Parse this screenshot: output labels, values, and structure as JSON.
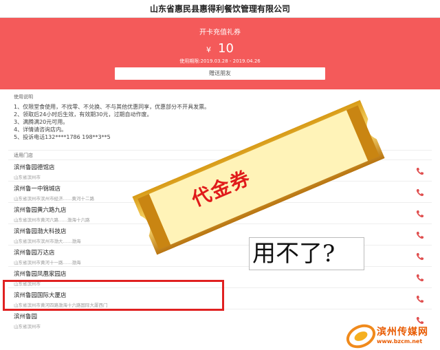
{
  "header": {
    "title": "山东省惠民县惠得利餐饮管理有限公司"
  },
  "hero": {
    "title": "开卡充值礼券",
    "currency": "¥",
    "amount": "10",
    "validity": "使用期限:2019.03.28 - 2019.04.26",
    "button_label": "赠送朋友"
  },
  "rules": {
    "heading": "使用说明",
    "items": [
      "1、仅限堂食使用，不找零、不兑换、不与其他优惠同享，优惠部分不开具发票。",
      "2、领取后24小时后生效，有效期30元，过期自动作废。",
      "3、满腾满20元可用。",
      "4、详情请咨询店内。",
      "5、投诉电话132****1786 198**3**5"
    ]
  },
  "stores": {
    "heading": "适用门店",
    "items": [
      {
        "name": "滨州鲁园德馆店",
        "address": "山东省滨州市"
      },
      {
        "name": "滨州鲁一中锦城店",
        "address": "山东省滨州市滨州市经济……黄河十二路"
      },
      {
        "name": "滨州鲁园黄六路九店",
        "address": "山东省滨州市黄河六路……渤海十六路"
      },
      {
        "name": "滨州鲁园渤大科技店",
        "address": "山东省滨州市滨州市渤大……渤海"
      },
      {
        "name": "滨州鲁园万达店",
        "address": "山东省滨州市黄河十一路……渤海"
      },
      {
        "name": "滨州鲁园凤凰家园店",
        "address": "山东省滨州市"
      },
      {
        "name": "滨州鲁园国际大厦店",
        "address": "山东省滨州市黄河四路渤海十六路国际大厦西门"
      },
      {
        "name": "滨州鲁园",
        "address": "山东省滨州市"
      }
    ]
  },
  "overlay": {
    "voucher_text": "代金券",
    "question_text": "用不了?"
  },
  "watermark": {
    "name": "滨州传媒网",
    "url": "www.bzcm.net"
  },
  "colors": {
    "accent": "#f45a5a",
    "highlight": "#e02020",
    "phone": "#e05050"
  }
}
